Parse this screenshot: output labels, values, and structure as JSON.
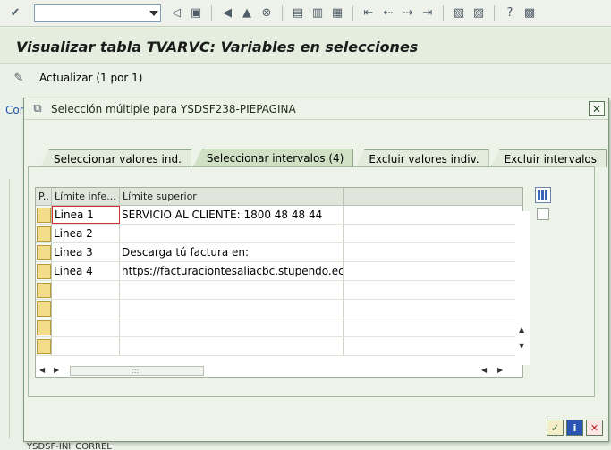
{
  "window": {
    "title": "Visualizar tabla TVARVC: Variables en selecciones",
    "app_toolbar_label": "Actualizar (1 por 1)",
    "bg_link_fragment": "Con",
    "bg_bottom_fragment": "YSDSF-INI_CORREL"
  },
  "toolbar_icons": [
    "check-icon",
    "back-icon",
    "save-icon",
    "nav-back-icon",
    "nav-exit-icon",
    "cancel-icon",
    "print-icon",
    "find-icon",
    "find-next-icon",
    "first-page-icon",
    "prev-page-icon",
    "next-page-icon",
    "last-page-icon",
    "new-session-icon",
    "shortcut-icon",
    "help-icon",
    "layout-icon"
  ],
  "dialog": {
    "title": "Selección múltiple para YSDSF238-PIEPAGINA",
    "tabs": [
      {
        "label": "Seleccionar valores ind."
      },
      {
        "label": "Seleccionar intervalos (4)"
      },
      {
        "label": "Excluir valores indiv."
      },
      {
        "label": "Excluir intervalos"
      }
    ],
    "active_tab": 1,
    "columns": {
      "c0": "P..",
      "c1": "Límite infe...",
      "c2": "Límite superior"
    },
    "rows": [
      {
        "low": "Linea 1",
        "high": "SERVICIO AL CLIENTE: 1800 48 48 44"
      },
      {
        "low": "Linea 2",
        "high": ""
      },
      {
        "low": "Linea 3",
        "high": "Descarga tú factura en:"
      },
      {
        "low": "Linea 4",
        "high": "https://facturaciontesaliacbc.stupendo.ec/"
      },
      {
        "low": "",
        "high": ""
      },
      {
        "low": "",
        "high": ""
      },
      {
        "low": "",
        "high": ""
      },
      {
        "low": "",
        "high": ""
      }
    ],
    "scroll_thumb_glyph": ":::",
    "footer": {
      "ok": "✓",
      "info": "i",
      "cancel": "✕"
    }
  }
}
